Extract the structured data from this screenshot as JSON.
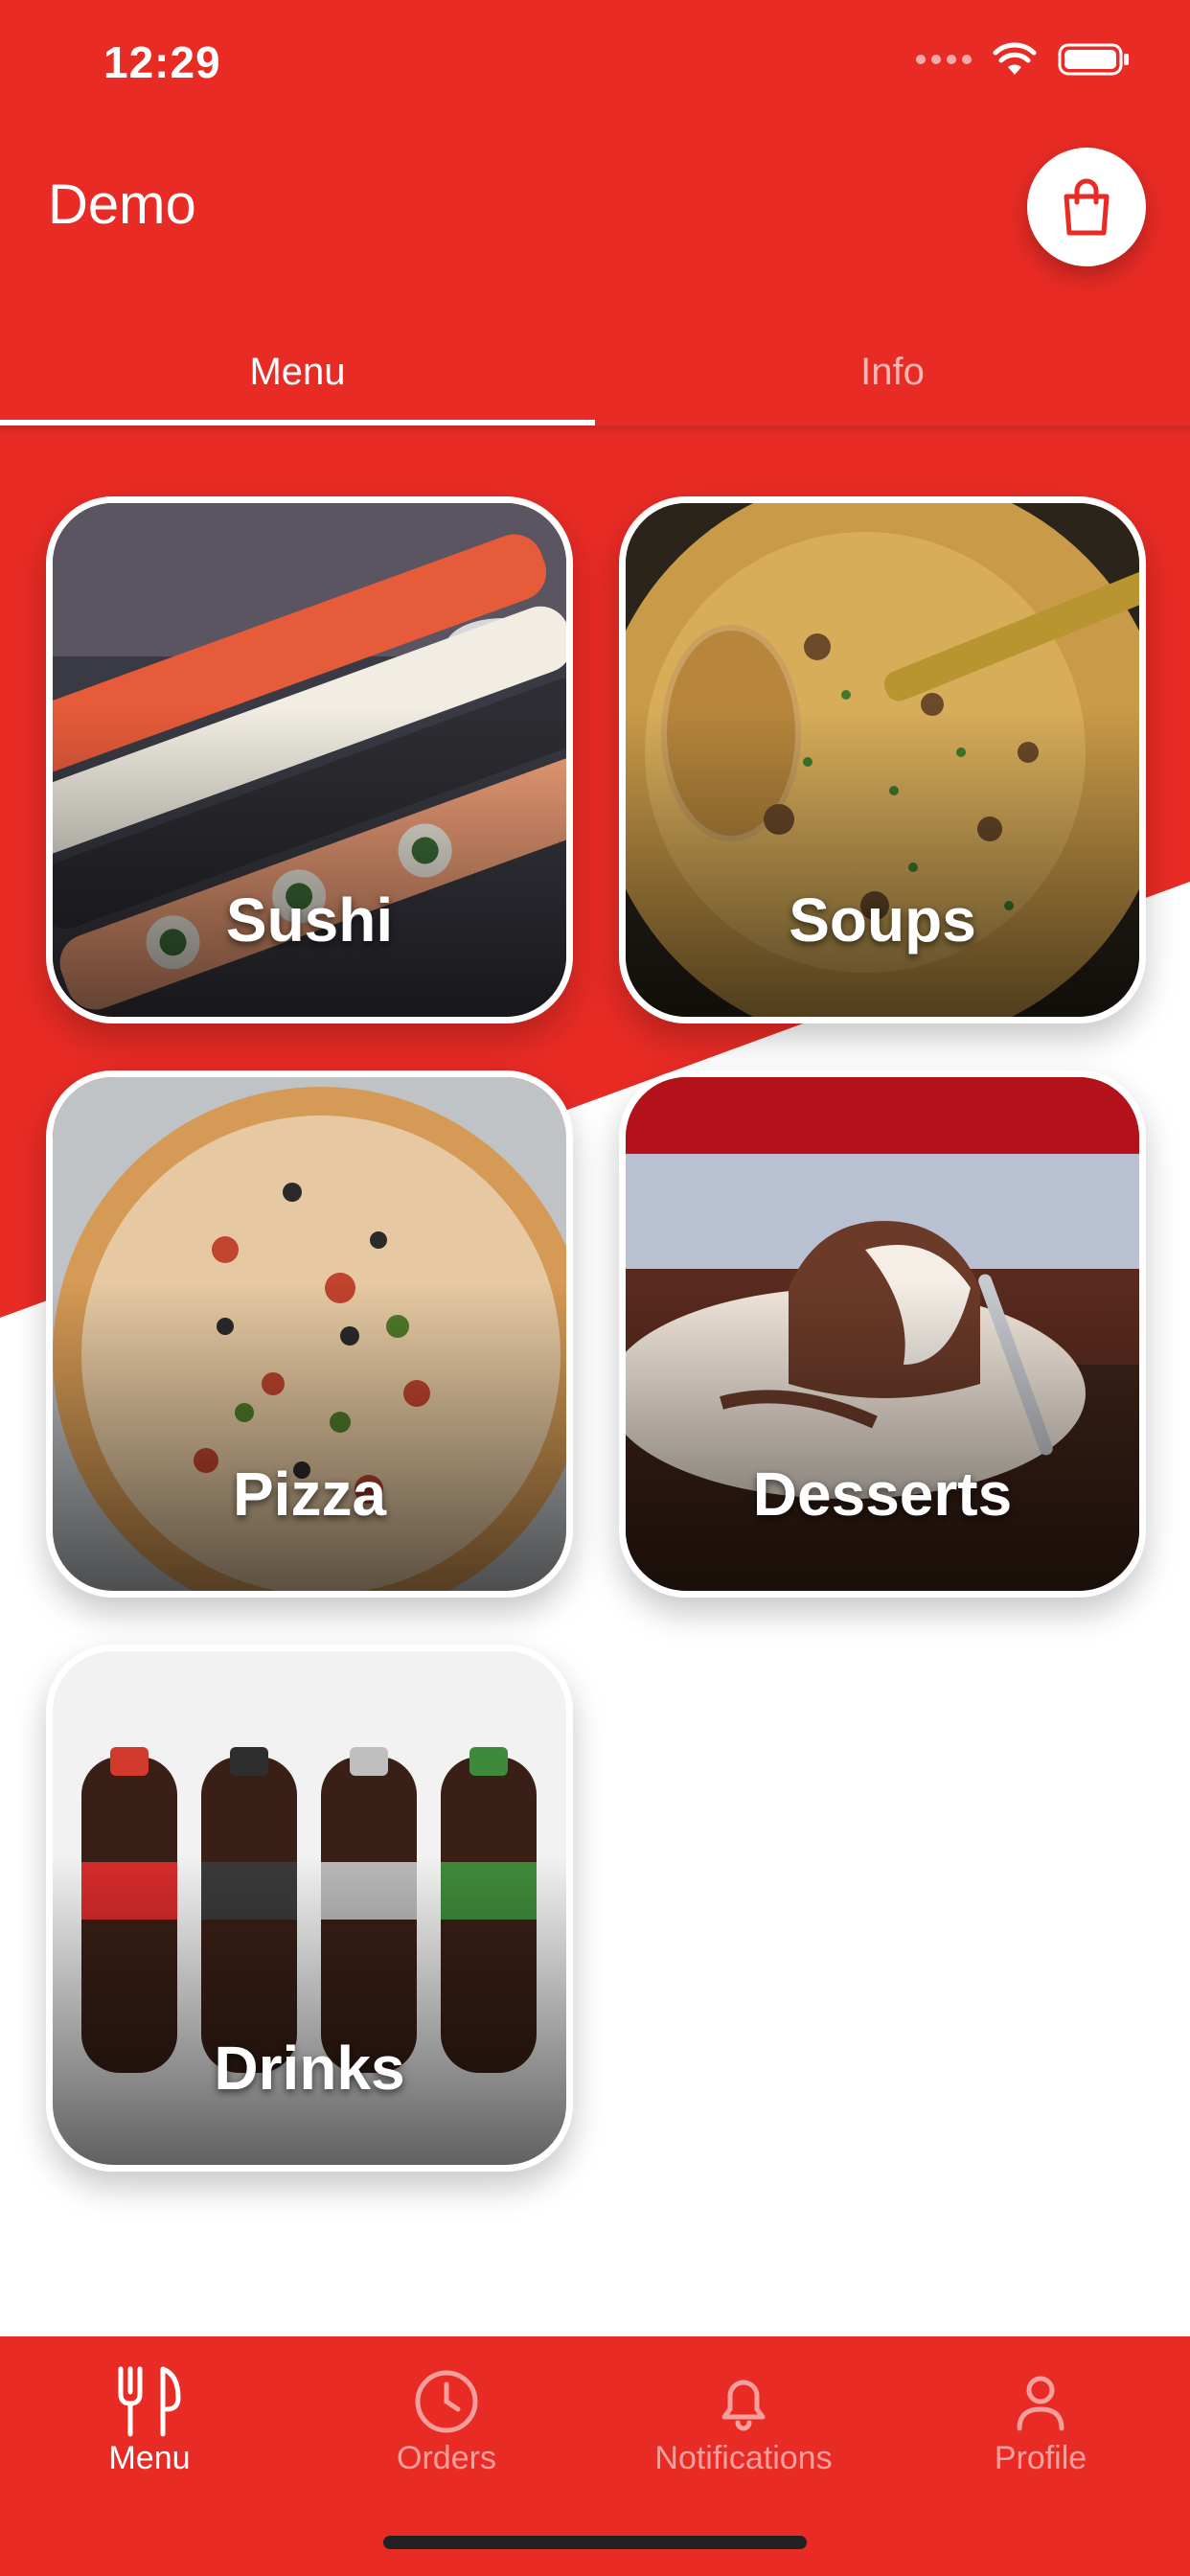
{
  "status_bar": {
    "time": "12:29"
  },
  "app_bar": {
    "title": "Demo",
    "cart_icon": "shopping-bag-icon"
  },
  "tabs": [
    {
      "label": "Menu",
      "active": true
    },
    {
      "label": "Info",
      "active": false
    }
  ],
  "categories": [
    {
      "label": "Sushi"
    },
    {
      "label": "Soups"
    },
    {
      "label": "Pizza"
    },
    {
      "label": "Desserts"
    },
    {
      "label": "Drinks"
    }
  ],
  "bottom_nav": [
    {
      "label": "Menu",
      "icon": "fork-knife-icon",
      "active": true
    },
    {
      "label": "Orders",
      "icon": "clock-icon",
      "active": false
    },
    {
      "label": "Notifications",
      "icon": "bell-icon",
      "active": false
    },
    {
      "label": "Profile",
      "icon": "user-icon",
      "active": false
    }
  ],
  "colors": {
    "primary": "#e82b25",
    "surface": "#ffffff"
  }
}
